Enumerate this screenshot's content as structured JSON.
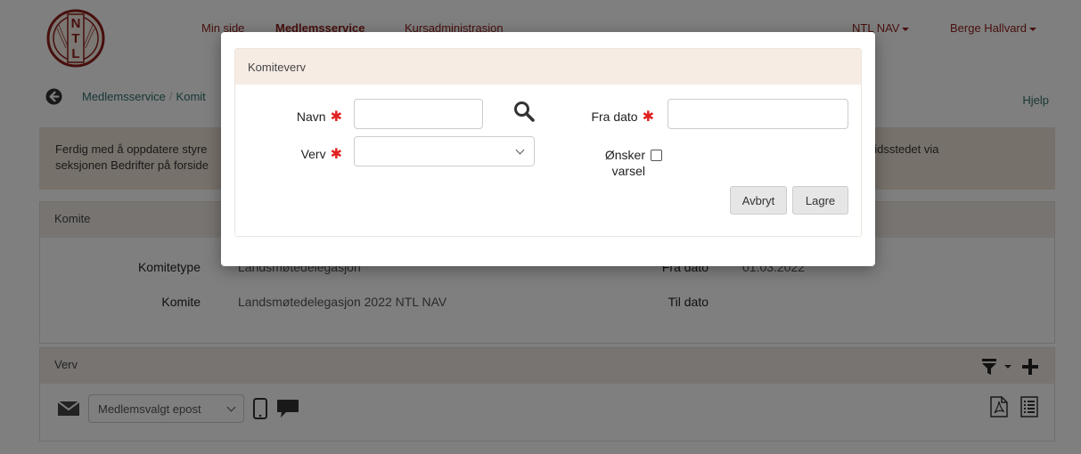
{
  "nav": {
    "items": [
      {
        "label": "Min side",
        "active": false
      },
      {
        "label": "Medlemsservice",
        "active": true
      },
      {
        "label": "Kursadministrasjon",
        "active": false
      }
    ],
    "org_menu": "NTL NAV",
    "user_menu": "Berge Hallvard",
    "logo_letters": "NTL"
  },
  "breadcrumb": {
    "root": "Medlemsservice",
    "current": "Komit",
    "help": "Hjelp"
  },
  "notice": {
    "line1": "Ferdig med å oppdatere styre",
    "line2": "seksjonen Bedrifter på forside",
    "line1_right": "eidsstedet via"
  },
  "komite_panel": {
    "heading": "Komite",
    "fields": {
      "komitetype_label": "Komitetype",
      "komitetype_value": "Landsmøtedelegasjon",
      "komite_label": "Komite",
      "komite_value": "Landsmøtedelegasjon 2022 NTL NAV",
      "fra_dato_label": "Fra dato",
      "fra_dato_value": "01.03.2022",
      "til_dato_label": "Til dato",
      "til_dato_value": ""
    }
  },
  "verv_panel": {
    "heading": "Verv",
    "email_select_value": "Medlemsvalgt epost"
  },
  "modal": {
    "title": "Komiteverv",
    "navn_label": "Navn",
    "navn_value": "",
    "verv_label": "Verv",
    "verv_value": "",
    "fra_dato_label": "Fra dato",
    "fra_dato_value": "",
    "onsker_varsel_line1": "Ønsker",
    "onsker_varsel_line2": "varsel",
    "onsker_varsel_checked": false,
    "cancel_label": "Avbryt",
    "save_label": "Lagre",
    "required_marker": "✱"
  },
  "colors": {
    "brand": "#8f1f1a",
    "link": "#2e6f6a",
    "notice_bg": "#eee3d7",
    "panel_heading_bg": "#f0e9e3",
    "required": "#e02020"
  },
  "icons": [
    "back-icon",
    "search-icon",
    "filter-icon",
    "plus-icon",
    "envelope-icon",
    "mobile-icon",
    "chat-icon",
    "pdf-icon",
    "list-icon"
  ]
}
